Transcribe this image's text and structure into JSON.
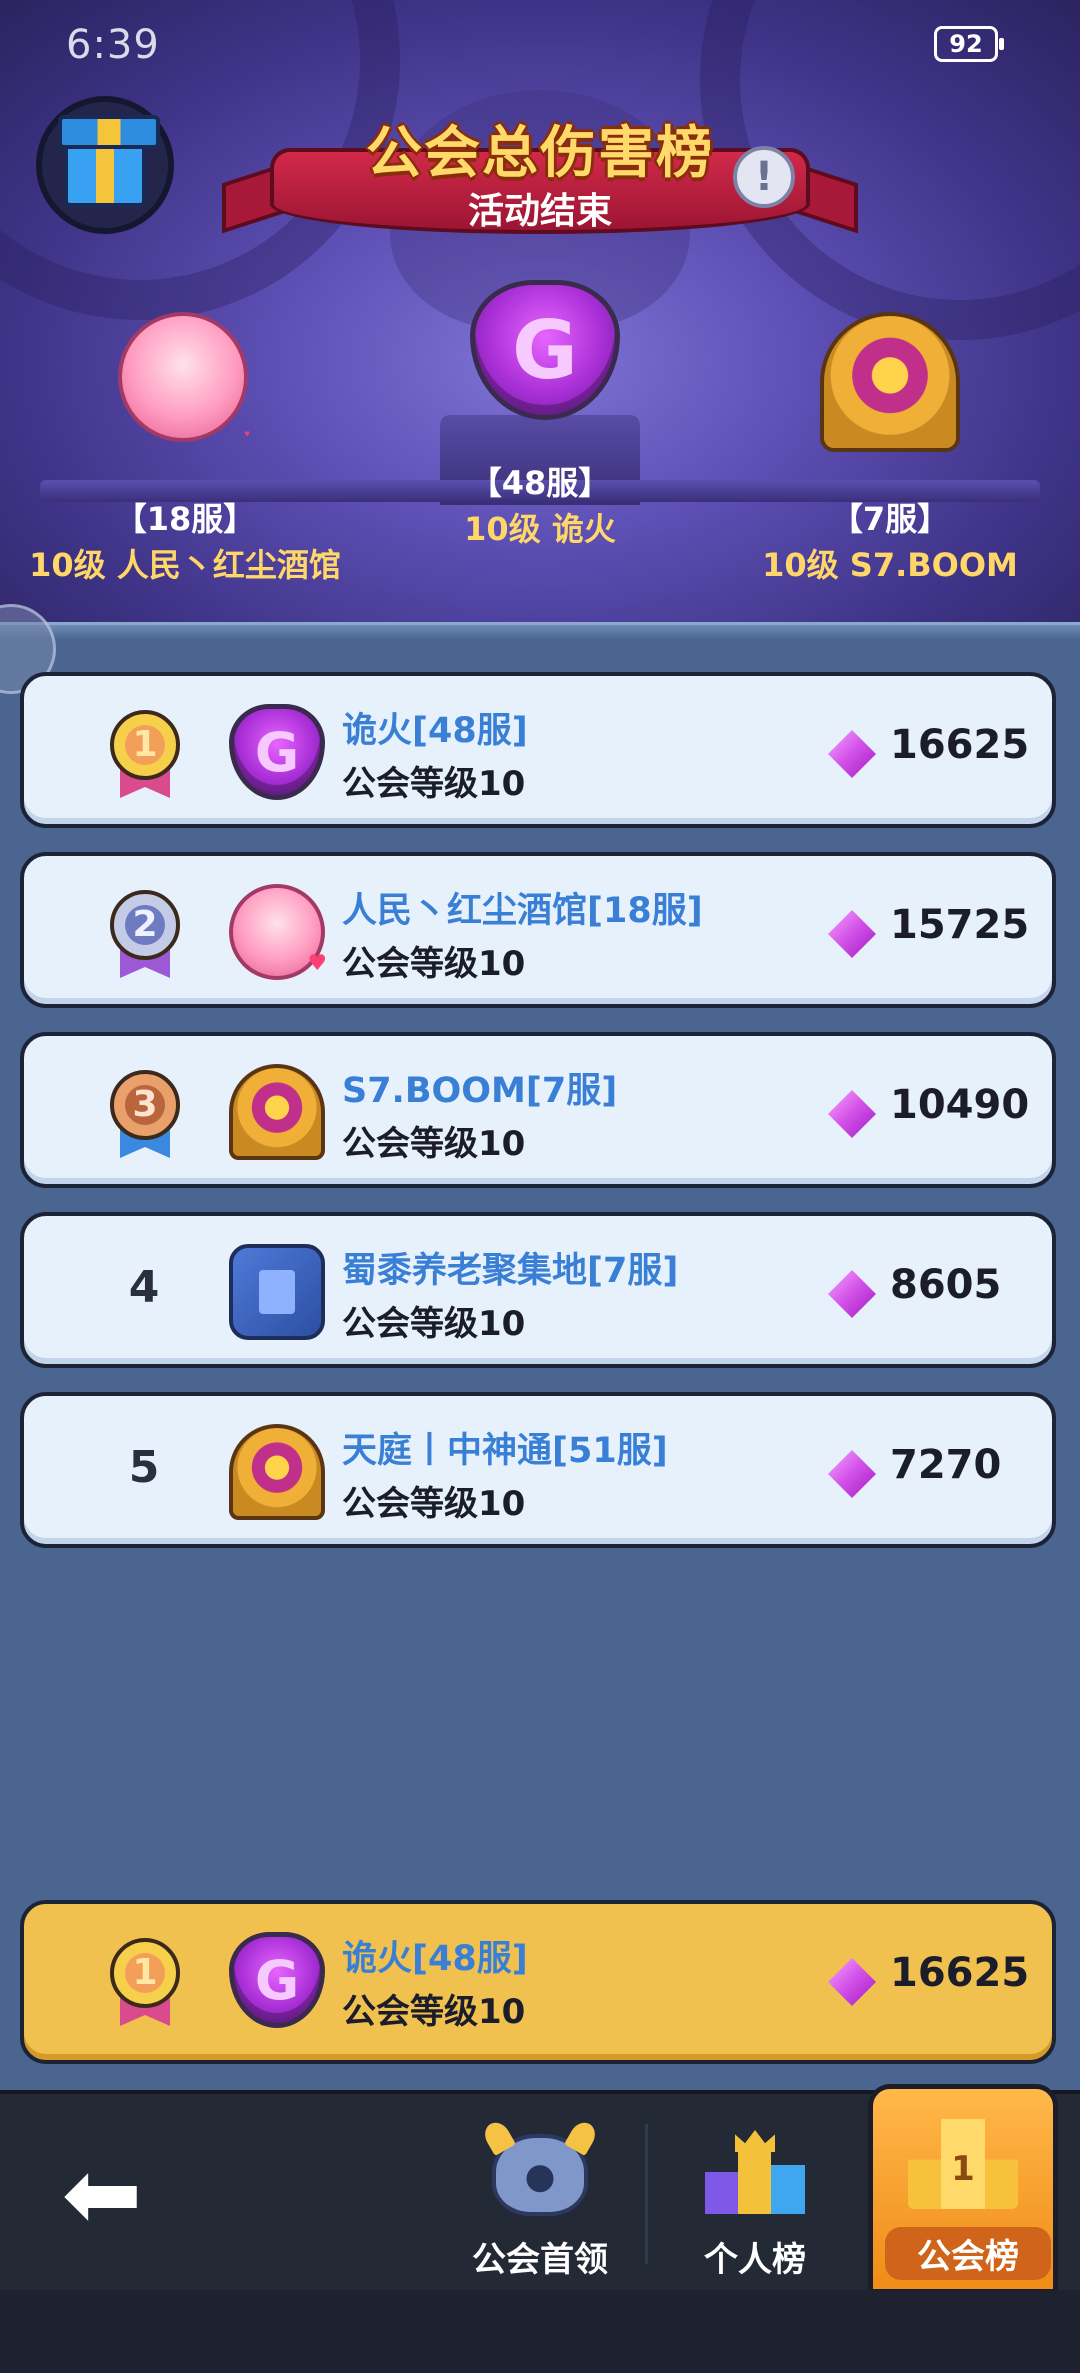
{
  "status_bar": {
    "time": "6:39",
    "battery": "92"
  },
  "header": {
    "title": "公会总伤害榜",
    "subtitle": "活动结束",
    "gift_icon": "gift-icon",
    "info_icon": "exclamation-icon",
    "info_glyph": "!"
  },
  "podium": {
    "first": {
      "server": "【48服】",
      "guild": "10级  诡火",
      "emblem": "purple-flame-shield"
    },
    "second": {
      "server": "【18服】",
      "guild": "10级  人民丶红尘酒馆",
      "emblem": "pink-cat-girl"
    },
    "third": {
      "server": "【7服】",
      "guild": "10级  S7.BOOM",
      "emblem": "golden-eye-pyramid"
    }
  },
  "rankings": [
    {
      "rank": "1",
      "name": "诡火[48服]",
      "level": "公会等级10",
      "score": "16625",
      "medal": "gold"
    },
    {
      "rank": "2",
      "name": "人民丶红尘酒馆[18服]",
      "level": "公会等级10",
      "score": "15725",
      "medal": "silver"
    },
    {
      "rank": "3",
      "name": "S7.BOOM[7服]",
      "level": "公会等级10",
      "score": "10490",
      "medal": "bronze"
    },
    {
      "rank": "4",
      "name": "蜀黍养老聚集地[7服]",
      "level": "公会等级10",
      "score": "8605"
    },
    {
      "rank": "5",
      "name": "天庭丨中神通[51服]",
      "level": "公会等级10",
      "score": "7270"
    }
  ],
  "my_guild": {
    "rank": "1",
    "name": "诡火[48服]",
    "level": "公会等级10",
    "score": "16625"
  },
  "bottom_nav": {
    "back_glyph": "⬅",
    "items": [
      {
        "label": "公会首领",
        "icon": "boss-icon"
      },
      {
        "label": "个人榜",
        "icon": "podium-icon"
      },
      {
        "label": "公会榜",
        "icon": "guild-ranking-icon",
        "active": true,
        "badge": "1"
      }
    ]
  },
  "colors": {
    "list_bg": "#e6f1fc",
    "my_row_bg": "#f1c150",
    "name_blue": "#3a7fd6",
    "active_tab": "#f08c18",
    "gem": "#d24fe8"
  }
}
